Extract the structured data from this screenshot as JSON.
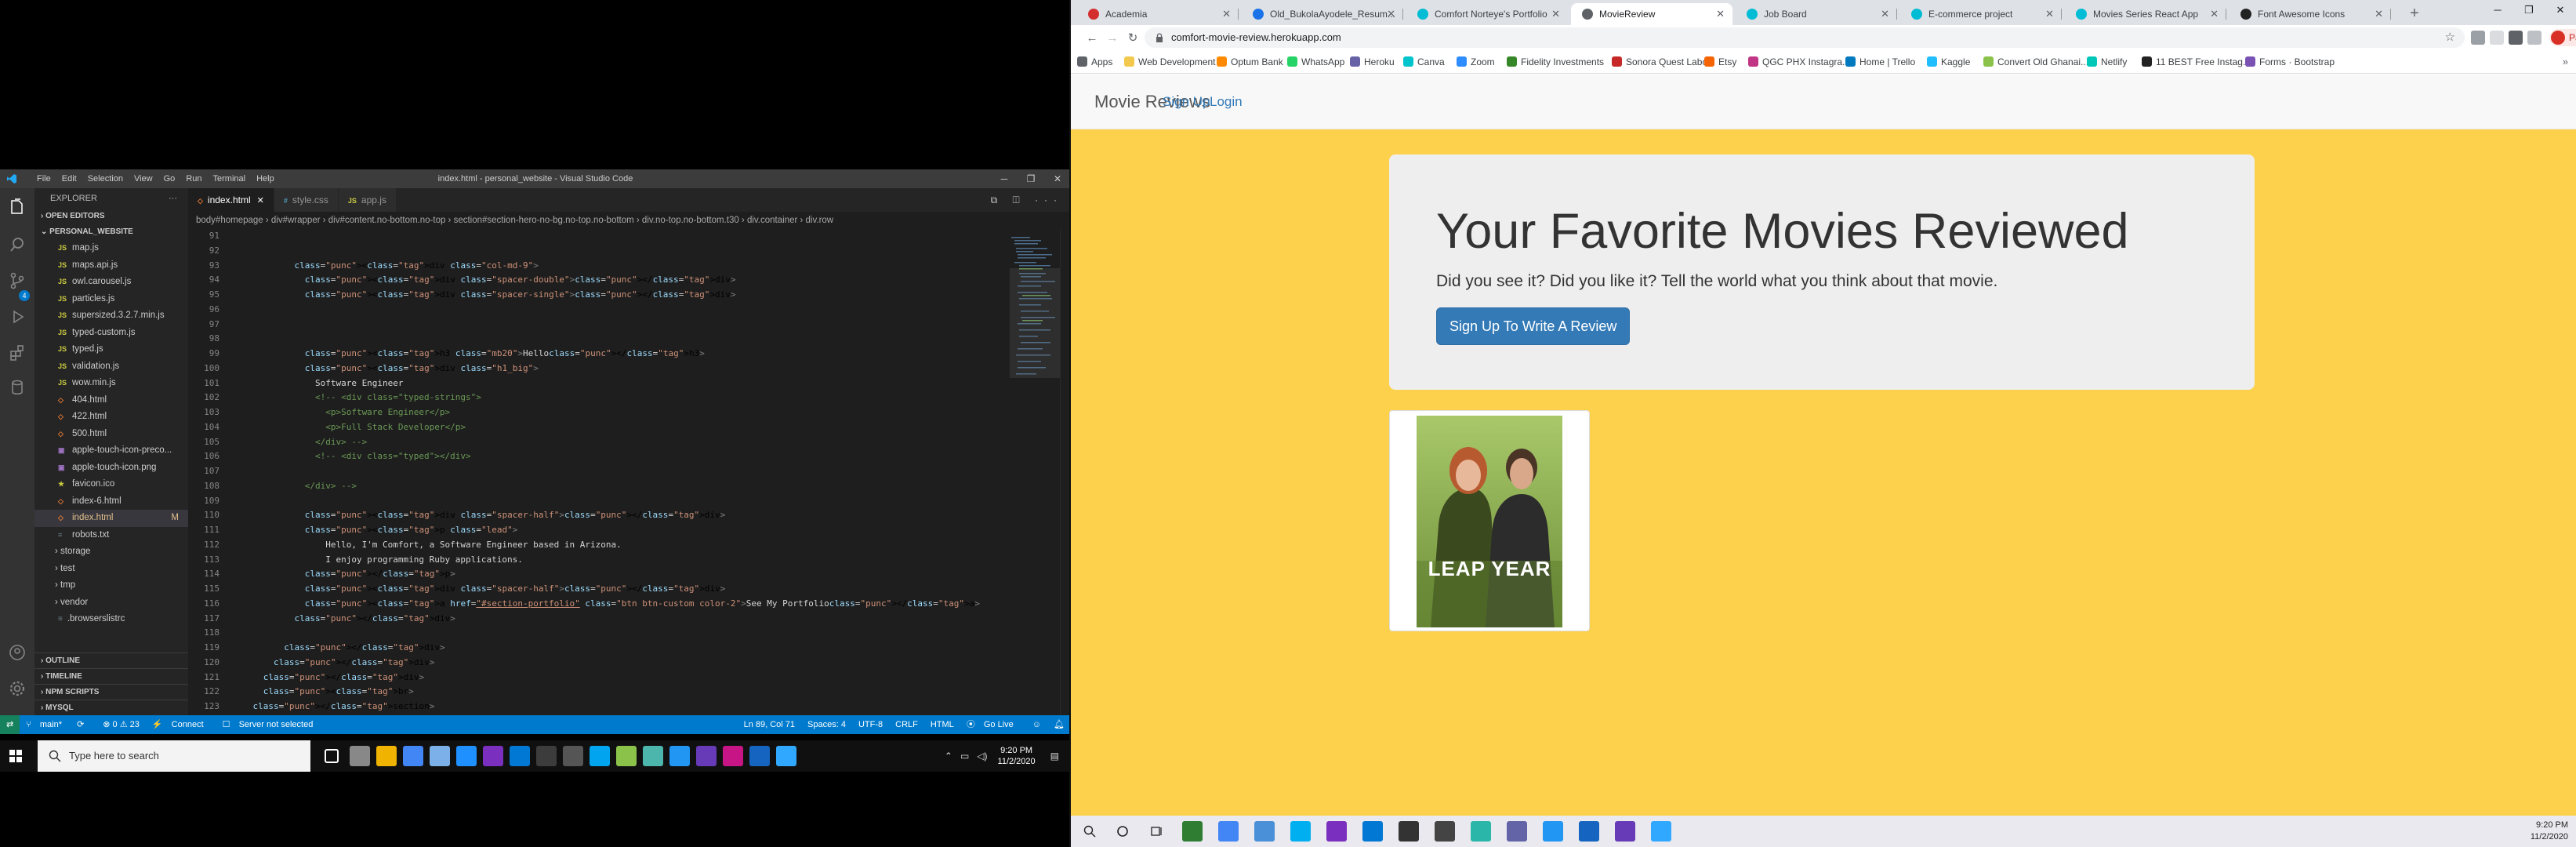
{
  "vscode": {
    "window_title": "index.html - personal_website - Visual Studio Code",
    "menu": [
      "File",
      "Edit",
      "Selection",
      "View",
      "Go",
      "Run",
      "Terminal",
      "Help"
    ],
    "sidebar": {
      "header": "EXPLORER",
      "open_editors": "OPEN EDITORS",
      "project": "PERSONAL_WEBSITE",
      "files": [
        {
          "icon": "JS",
          "name": "map.js",
          "color": "#cbcb41"
        },
        {
          "icon": "JS",
          "name": "maps.api.js",
          "color": "#cbcb41"
        },
        {
          "icon": "JS",
          "name": "owl.carousel.js",
          "color": "#cbcb41"
        },
        {
          "icon": "JS",
          "name": "particles.js",
          "color": "#cbcb41"
        },
        {
          "icon": "JS",
          "name": "supersized.3.2.7.min.js",
          "color": "#cbcb41"
        },
        {
          "icon": "JS",
          "name": "typed-custom.js",
          "color": "#cbcb41"
        },
        {
          "icon": "JS",
          "name": "typed.js",
          "color": "#cbcb41"
        },
        {
          "icon": "JS",
          "name": "validation.js",
          "color": "#cbcb41"
        },
        {
          "icon": "JS",
          "name": "wow.min.js",
          "color": "#cbcb41"
        },
        {
          "icon": "◇",
          "name": "404.html",
          "color": "#e37933"
        },
        {
          "icon": "◇",
          "name": "422.html",
          "color": "#e37933"
        },
        {
          "icon": "◇",
          "name": "500.html",
          "color": "#e37933"
        },
        {
          "icon": "▣",
          "name": "apple-touch-icon-preco...",
          "color": "#a074c4"
        },
        {
          "icon": "▣",
          "name": "apple-touch-icon.png",
          "color": "#a074c4"
        },
        {
          "icon": "★",
          "name": "favicon.ico",
          "color": "#cbcb41"
        },
        {
          "icon": "◇",
          "name": "index-6.html",
          "color": "#e37933"
        },
        {
          "icon": "◇",
          "name": "index.html",
          "color": "#e37933"
        },
        {
          "icon": "≡",
          "name": "robots.txt",
          "color": "#6d8086"
        }
      ],
      "modified_marker": "M",
      "folders": [
        "storage",
        "test",
        "tmp",
        "vendor"
      ],
      "dotfile": ".browserslistrc",
      "bottom_sections": [
        "OUTLINE",
        "TIMELINE",
        "NPM SCRIPTS",
        "MYSQL"
      ]
    },
    "tabs": [
      {
        "icon": "◇",
        "label": "index.html",
        "color": "#e37933"
      },
      {
        "icon": "#",
        "label": "style.css",
        "color": "#519aba"
      },
      {
        "icon": "JS",
        "label": "app.js",
        "color": "#cbcb41"
      }
    ],
    "breadcrumb": "body#homepage  ›  div#wrapper  ›  div#content.no-bottom.no-top  ›  section#section-hero-no-bg.no-top.no-bottom  ›  div.no-top.no-bottom.t30  ›  div.container  ›  div.row",
    "line_numbers": [
      "91",
      "92",
      "93",
      "94",
      "95",
      "96",
      "97",
      "98",
      "99",
      "100",
      "101",
      "102",
      "103",
      "104",
      "105",
      "106",
      "107",
      "108",
      "109",
      "110",
      "111",
      "112",
      "113",
      "114",
      "115",
      "116",
      "117",
      "118",
      "119",
      "120",
      "121",
      "122",
      "123"
    ],
    "code_lines": [
      "",
      "",
      "            <div class=\"col-md-9\">",
      "              <div class=\"spacer-double\"></div>",
      "              <div class=\"spacer-single\"></div>",
      "",
      "",
      "",
      "              <h3 class=\"mb20\">Hello</h3>",
      "              <div class=\"h1_big\">",
      "                Software Engineer",
      "                <!-- <div class=\"typed-strings\">",
      "                  <p>Software Engineer</p>",
      "                  <p>Full Stack Developer</p>",
      "                </div> -->",
      "                <!-- <div class=\"typed\"></div>",
      "",
      "              </div> -->",
      "",
      "              <div class=\"spacer-half\"></div>",
      "              <p class=\"lead\">",
      "                  Hello, I'm Comfort, a Software Engineer based in Arizona.",
      "                  I enjoy programming Ruby applications.",
      "              </p>",
      "              <div class=\"spacer-half\"></div>",
      "              <a href=\"#section-portfolio\" class=\"btn btn-custom color-2\">See My Portfolio</a>",
      "            </div>",
      "",
      "          </div>",
      "        </div>",
      "      </div>",
      "      <br>",
      "    </section>"
    ],
    "status": {
      "branch": "main*",
      "sync": "⟳",
      "problems": "⊗ 0 ⚠ 23",
      "connect": "Connect",
      "server": "Server not selected",
      "position": "Ln 89, Col 71",
      "spaces": "Spaces: 4",
      "encoding": "UTF-8",
      "eol": "CRLF",
      "language": "HTML",
      "golive": "Go Live"
    }
  },
  "left_taskbar": {
    "search_placeholder": "Type here to search",
    "time": "9:20 PM",
    "date": "11/2/2020",
    "app_colors": [
      "#888888",
      "#f0b400",
      "#4285f4",
      "#7bb1e8",
      "#1e90ff",
      "#7b2fbe",
      "#0078d4",
      "#3c3c3c",
      "#555555",
      "#00a4ef",
      "#8bc34a",
      "#4db6ac",
      "#2196f3",
      "#673ab7",
      "#c71585",
      "#1565c0",
      "#31a8ff"
    ]
  },
  "browser": {
    "tabs": [
      {
        "label": "Academia",
        "favicon_color": "#d32f2f"
      },
      {
        "label": "Old_BukolaAyodele_Resum...",
        "favicon_color": "#1a73e8"
      },
      {
        "label": "Comfort Norteye's Portfolio",
        "favicon_color": "#00bcd4"
      },
      {
        "label": "MovieReview",
        "favicon_color": "#5f6368"
      },
      {
        "label": "Job Board",
        "favicon_color": "#00bcd4"
      },
      {
        "label": "E-commerce project",
        "favicon_color": "#00bcd4"
      },
      {
        "label": "Movies Series React App",
        "favicon_color": "#00bcd4"
      },
      {
        "label": "Font Awesome Icons",
        "favicon_color": "#222222"
      }
    ],
    "active_tab": 3,
    "url": "comfort-movie-review.herokuapp.com",
    "profile_label": "Paused",
    "bookmarks": [
      {
        "label": "Apps",
        "color": "#5f6368"
      },
      {
        "label": "Web Development",
        "color": "#f2c94c"
      },
      {
        "label": "Optum Bank",
        "color": "#ff8a00"
      },
      {
        "label": "WhatsApp",
        "color": "#25d366"
      },
      {
        "label": "Heroku",
        "color": "#6762a6"
      },
      {
        "label": "Canva",
        "color": "#00c4cc"
      },
      {
        "label": "Zoom",
        "color": "#2d8cff"
      },
      {
        "label": "Fidelity Investments",
        "color": "#368727"
      },
      {
        "label": "Sonora Quest Labo...",
        "color": "#c62828"
      },
      {
        "label": "Etsy",
        "color": "#f56400"
      },
      {
        "label": "QGC PHX Instagra...",
        "color": "#c13584"
      },
      {
        "label": "Home | Trello",
        "color": "#0079bf"
      },
      {
        "label": "Kaggle",
        "color": "#20beff"
      },
      {
        "label": "Convert Old Ghanai...",
        "color": "#8bc34a"
      },
      {
        "label": "Netlify",
        "color": "#00c7b7"
      },
      {
        "label": "11 BEST Free Instag...",
        "color": "#222222"
      },
      {
        "label": "Forms · Bootstrap",
        "color": "#7952b3"
      }
    ],
    "bookmarks_more": "»"
  },
  "page": {
    "brand": "Movie Reviews",
    "nav_signup": "Sign Up",
    "nav_login": "Login",
    "hero_title": "Your Favorite Movies Reviewed",
    "hero_lead": "Did you see it? Did you like it? Tell the world what you think about that movie.",
    "hero_button": "Sign Up To Write A Review",
    "poster_title": "LEAP YEAR",
    "colors": {
      "background": "#fdd14c",
      "button": "#337ab7",
      "jumbotron": "#eeeeee"
    }
  },
  "right_taskbar": {
    "time": "9:20 PM",
    "date": "11/2/2020",
    "app_colors": [
      "#2e7d32",
      "#4285f4",
      "#4a90d9",
      "#00aff0",
      "#7b2fbe",
      "#0078d4",
      "#333333",
      "#444444",
      "#2ab7a9",
      "#6264a7",
      "#2196f3",
      "#1565c0",
      "#673ab7",
      "#31a8ff"
    ]
  }
}
